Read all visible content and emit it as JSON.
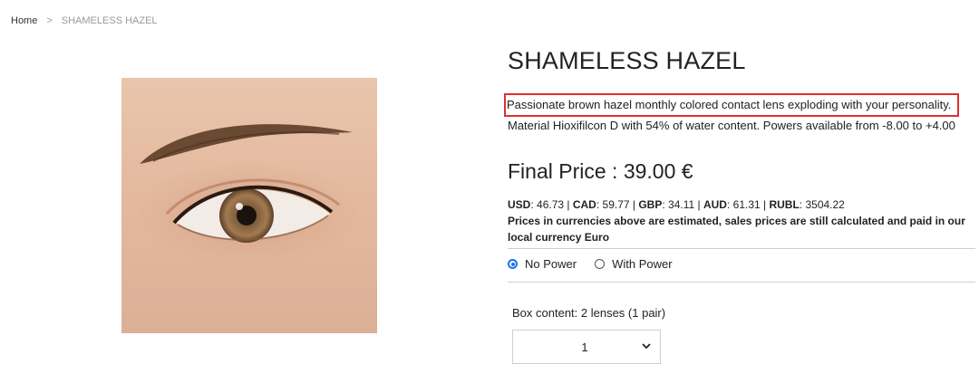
{
  "breadcrumb": {
    "home": "Home",
    "separator": ">",
    "current": "SHAMELESS HAZEL"
  },
  "product": {
    "image_alt": "hazel-eye-product-image",
    "title": "SHAMELESS HAZEL",
    "description_highlighted": "Passionate brown hazel monthly colored contact lens exploding with your personality.",
    "description_line2": "Material Hioxifilcon D with 54% of water content. Powers available from -8.00 to +4.00",
    "price_label": "Final Price : 39.00 €"
  },
  "currencies": {
    "items": [
      {
        "code": "USD",
        "value": "46.73"
      },
      {
        "code": "CAD",
        "value": "59.77"
      },
      {
        "code": "GBP",
        "value": "34.11"
      },
      {
        "code": "AUD",
        "value": "61.31"
      },
      {
        "code": "RUBL",
        "value": "3504.22"
      }
    ],
    "note": "Prices in currencies above are estimated, sales prices are still calculated and paid in our local currency Euro"
  },
  "power_options": {
    "selected": "No Power",
    "options": [
      "No Power",
      "With Power"
    ]
  },
  "box_content": "Box content: 2 lenses (1 pair)",
  "quantity": {
    "selected": "1"
  },
  "colors": {
    "highlight_border": "#e0302f",
    "radio_accent": "#1a73e8"
  }
}
